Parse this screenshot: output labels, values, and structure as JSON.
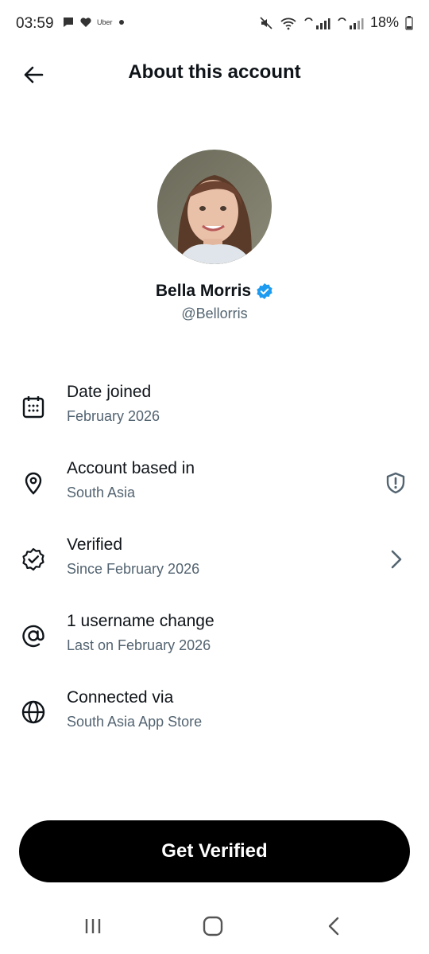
{
  "status_bar": {
    "time": "03:59",
    "uber_label": "Uber",
    "battery": "18%"
  },
  "header": {
    "title": "About this account",
    "back_icon": "arrow-left-icon"
  },
  "profile": {
    "name": "Bella Morris",
    "handle": "@Bellorris",
    "verified_color": "#1d9bf0"
  },
  "info_items": [
    {
      "icon": "calendar-icon",
      "title": "Date joined",
      "subtitle": "February 2026"
    },
    {
      "icon": "location-pin-icon",
      "title": "Account based in",
      "subtitle": "South Asia",
      "trailing": "shield-alert-icon"
    },
    {
      "icon": "verified-badge-icon",
      "title": "Verified",
      "subtitle": "Since February 2026",
      "trailing": "chevron-right-icon"
    },
    {
      "icon": "at-sign-icon",
      "title": "1 username change",
      "subtitle": "Last on February 2026"
    },
    {
      "icon": "globe-icon",
      "title": "Connected via",
      "subtitle": "South Asia App Store"
    }
  ],
  "cta": {
    "label": "Get Verified"
  },
  "colors": {
    "text_primary": "#0f1419",
    "text_secondary": "#536471",
    "button_bg": "#000000"
  }
}
